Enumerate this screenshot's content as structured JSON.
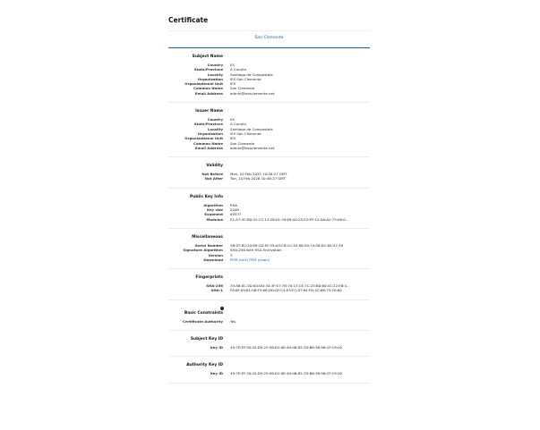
{
  "title": "Certificate",
  "tab": "San Clemente",
  "subject": {
    "title": "Subject Name",
    "rows": [
      {
        "label": "Country",
        "value": "ES"
      },
      {
        "label": "State/Province",
        "value": "A Coruña"
      },
      {
        "label": "Locality",
        "value": "Santiago de Compostela"
      },
      {
        "label": "Organization",
        "value": "IES San Clemente"
      },
      {
        "label": "Organizational Unit",
        "value": "IES"
      },
      {
        "label": "Common Name",
        "value": "San Clemente"
      },
      {
        "label": "Email Address",
        "value": "admin@iessclemente.net"
      }
    ]
  },
  "issuer": {
    "title": "Issuer Name",
    "rows": [
      {
        "label": "Country",
        "value": "ES"
      },
      {
        "label": "State/Province",
        "value": "A Coruña"
      },
      {
        "label": "Locality",
        "value": "Santiago de Compostela"
      },
      {
        "label": "Organization",
        "value": "IES San Clemente"
      },
      {
        "label": "Organizational Unit",
        "value": "IES"
      },
      {
        "label": "Common Name",
        "value": "San Clemente"
      },
      {
        "label": "Email Address",
        "value": "admin@iessclemente.net"
      }
    ]
  },
  "validity": {
    "title": "Validity",
    "rows": [
      {
        "label": "Not Before",
        "value": "Mon, 10 Feb 2025 10:48:27 GMT"
      },
      {
        "label": "Not After",
        "value": "Tue, 10 Feb 2026 10:48:27 GMT"
      }
    ]
  },
  "pubkey": {
    "title": "Public Key Info",
    "rows": [
      {
        "label": "Algorithm",
        "value": "RSA"
      },
      {
        "label": "Key size",
        "value": "2048"
      },
      {
        "label": "Exponent",
        "value": "65537"
      },
      {
        "label": "Modulus",
        "value": "E1:47:4C:B0:32:CC:13:28:01:39:E8:00:25:E2:EF:12:DA:A2:75:08:0..."
      }
    ]
  },
  "misc": {
    "title": "Miscellaneous",
    "serial_label": "Serial Number",
    "serial_value": "3B:07:B2:20:89:CD:EF:35:A4:C8:CC:1E:98:39:74:58:DC:65:47:49",
    "sig_label": "Signature Algorithm",
    "sig_value": "SHA-256 with RSA Encryption",
    "version_label": "Version",
    "version_value": "3",
    "download_label": "Download",
    "pem_cert": "PEM (cert)",
    "pem_chain": "PEM (chain)"
  },
  "fingerprints": {
    "title": "Fingerprints",
    "rows": [
      {
        "label": "SHA-256",
        "value": "33:A8:0C:5D:64:DD:34:3F:E7:7B:70:13:CE:7C:25:B0:60:41:22:E8:4..."
      },
      {
        "label": "SHA-1",
        "value": "F8:6F:09:61:08:F5:66:DD:DF:C4:E5:FC:07:94:FD:2C:68:75:20:60"
      }
    ]
  },
  "basic": {
    "title": "Basic Constraints",
    "rows": [
      {
        "label": "Certificate Authority",
        "value": "Yes"
      }
    ]
  },
  "subjectkey": {
    "title": "Subject Key ID",
    "rows": [
      {
        "label": "Key ID",
        "value": "49:7E:EF:30:42:D5:25:58:D1:0E:49:08:82:7D:B6:36:96:CF:C9:00"
      }
    ]
  },
  "authkey": {
    "title": "Authority Key ID",
    "rows": [
      {
        "label": "Key ID",
        "value": "49:7E:EF:30:42:D5:25:58:D1:0E:49:08:82:7D:B6:36:96:CF:C9:00"
      }
    ]
  }
}
